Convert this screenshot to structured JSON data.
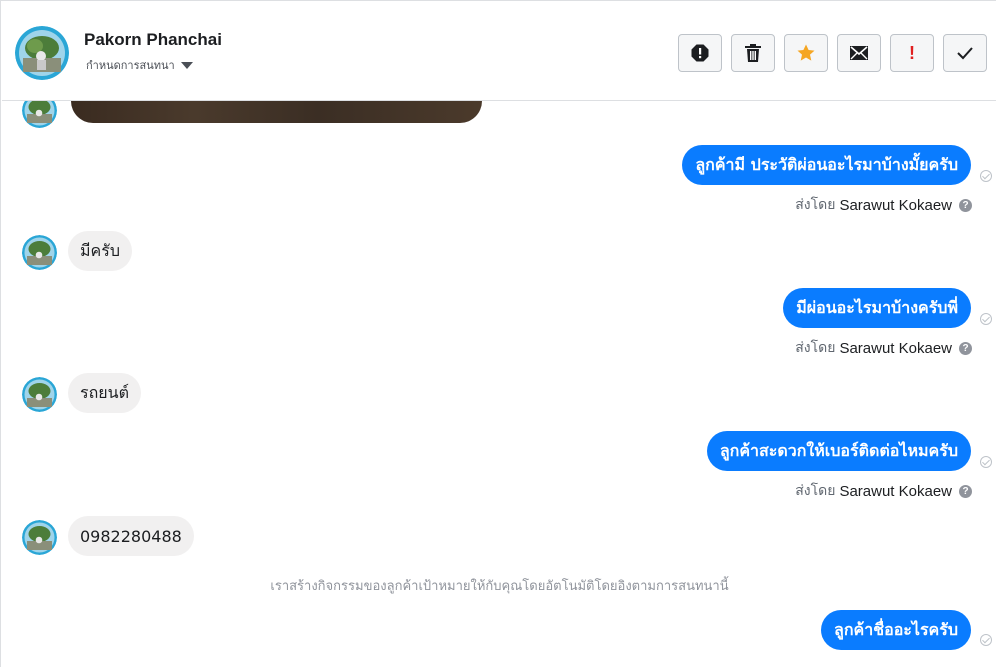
{
  "header": {
    "name": "Pakorn Phanchai",
    "subtitle": "กำหนดการสนทนา",
    "actions": [
      {
        "name": "report-icon"
      },
      {
        "name": "trash-icon"
      },
      {
        "name": "star-icon",
        "color": "#f5a623"
      },
      {
        "name": "envelope-icon"
      },
      {
        "name": "important-icon",
        "label": "!"
      },
      {
        "name": "check-icon"
      }
    ]
  },
  "messages": [
    {
      "dir": "out",
      "text": "ลูกค้ามี ประวัติผ่อนอะไรมาบ้างมั้ยครับ",
      "sent_by_prefix": "ส่งโดย",
      "sent_by_name": "Sarawut Kokaew"
    },
    {
      "dir": "in",
      "text": "มีครับ"
    },
    {
      "dir": "out",
      "text": "มีผ่อนอะไรมาบ้างครับพี่",
      "sent_by_prefix": "ส่งโดย",
      "sent_by_name": "Sarawut Kokaew"
    },
    {
      "dir": "in",
      "text": "รถยนต์"
    },
    {
      "dir": "out",
      "text": "ลูกค้าสะดวกให้เบอร์ติดต่อไหมครับ",
      "sent_by_prefix": "ส่งโดย",
      "sent_by_name": "Sarawut Kokaew"
    },
    {
      "dir": "in",
      "text": "0982280488"
    },
    {
      "dir": "system",
      "text": "เราสร้างกิจกรรมของลูกค้าเป้าหมายให้กับคุณโดยอัตโนมัติโดยอิงตามการสนทนานี้"
    },
    {
      "dir": "out",
      "text": "ลูกค้าชื่ออะไรครับ"
    }
  ],
  "colors": {
    "outgoing_bubble": "#0a7cff",
    "incoming_bubble": "#f1f0f0"
  }
}
